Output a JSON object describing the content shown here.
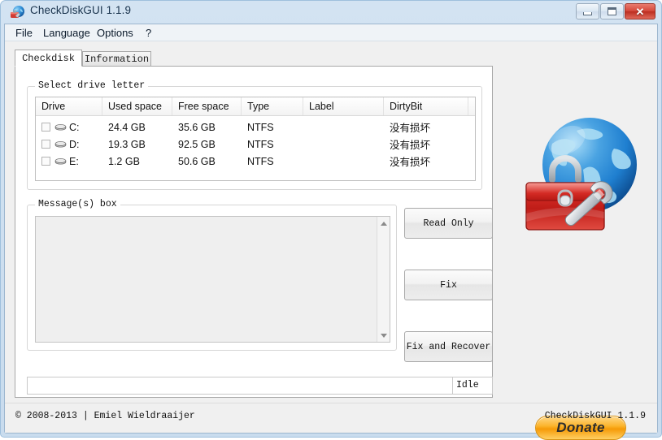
{
  "window": {
    "title": "CheckDiskGUI 1.1.9",
    "app_icon": "globe-toolbox-icon",
    "controls": {
      "minimize": "minimize-icon",
      "maximize": "maximize-icon",
      "close": "✕"
    },
    "frame_color": "#cfe0f0",
    "close_color": "#d4483a"
  },
  "menubar": {
    "items": [
      {
        "label": "File"
      },
      {
        "label": "Language"
      },
      {
        "label": "Options"
      },
      {
        "label": "?"
      }
    ]
  },
  "tabs": [
    {
      "label": "Checkdisk",
      "selected": true
    },
    {
      "label": "Information",
      "selected": false
    }
  ],
  "drive_group": {
    "label": "Select drive letter",
    "columns": [
      "Drive",
      "Used space",
      "Free space",
      "Type",
      "Label",
      "DirtyBit"
    ],
    "rows": [
      {
        "checked": false,
        "drive": "C:",
        "used_space": "24.4 GB",
        "free_space": "35.6 GB",
        "type": "NTFS",
        "label": "",
        "dirtybit": "没有损坏"
      },
      {
        "checked": false,
        "drive": "D:",
        "used_space": "19.3 GB",
        "free_space": "92.5 GB",
        "type": "NTFS",
        "label": "",
        "dirtybit": "没有损坏"
      },
      {
        "checked": false,
        "drive": "E:",
        "used_space": "1.2 GB",
        "free_space": "50.6 GB",
        "type": "NTFS",
        "label": "",
        "dirtybit": "没有损坏"
      }
    ]
  },
  "message_group": {
    "label": "Message(s) box",
    "content": "",
    "scrollbar": {
      "up": "scroll-up-icon",
      "down": "scroll-down-icon"
    }
  },
  "actions": {
    "read_only": "Read Only",
    "fix": "Fix",
    "fix_and_recover": "Fix and Recover"
  },
  "statusbar": {
    "message": "",
    "state": "Idle"
  },
  "logo": {
    "name": "globe-toolbox-graphic",
    "globe_color": "#1f7fd0",
    "toolbox_color": "#cf2222"
  },
  "donate": {
    "label": "Donate",
    "color": "#f59a07"
  },
  "footer": {
    "copyright": "© 2008-2013 | Emiel Wieldraaijer",
    "version": "CheckDiskGUI 1.1.9"
  }
}
